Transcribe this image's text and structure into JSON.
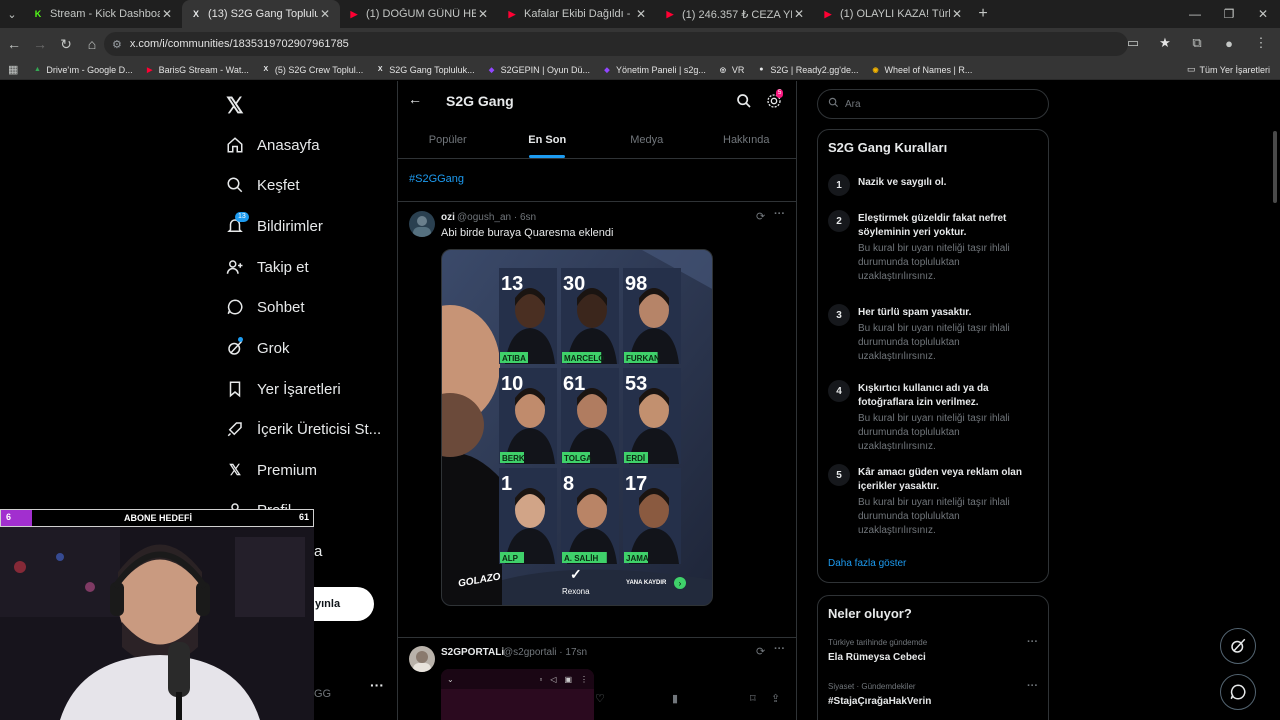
{
  "browser": {
    "tabs": [
      {
        "title": "Stream - Kick Dashboard",
        "fav": "K",
        "color": "#53fc18"
      },
      {
        "title": "(13) S2G Gang Topluluk / X",
        "fav": "X",
        "color": "#e7e9ea"
      },
      {
        "title": "(1) DOĞUM GÜNÜ HEDİYELERİ",
        "fav": "▶",
        "color": "#ff0033"
      },
      {
        "title": "Kafalar Ekibi Dağıldı - HESAP V",
        "fav": "▶",
        "color": "#ff0033"
      },
      {
        "title": "(1) 246.357 ₺ CEZA YEDİ! Türkiy",
        "fav": "▶",
        "color": "#ff0033"
      },
      {
        "title": "(1) OLAYLI KAZA! Türkiye'de Ya",
        "fav": "▶",
        "color": "#ff0033"
      }
    ],
    "url": "x.com/i/communities/1835319702907961785",
    "bookmarks": [
      "Drive'ım - Google D...",
      "BarisG Stream - Wat...",
      "(5) S2G Crew Toplul...",
      "S2G Gang Topluluk...",
      "S2GEPIN | Oyun Dü...",
      "Yönetim Paneli | s2g...",
      "VR",
      "S2G | Ready2.gg'de...",
      "Wheel of Names | R..."
    ],
    "all_bookmarks": "Tüm Yer İşaretleri"
  },
  "nav": {
    "home": "Anasayfa",
    "explore": "Keşfet",
    "notifications": "Bildirimler",
    "notif_count": "13",
    "follow": "Takip et",
    "chat": "Sohbet",
    "grok": "Grok",
    "bookmarks": "Yer İşaretleri",
    "creator": "İçerik Üreticisi St...",
    "premium": "Premium",
    "profile": "Profil",
    "more_partial": "a",
    "post_partial": "yınla",
    "account_partial": "GG"
  },
  "community": {
    "title": "S2G Gang",
    "settings_badge": "5",
    "tabs": [
      "Popüler",
      "En Son",
      "Medya",
      "Hakkında"
    ],
    "hashtag": "#S2GGang"
  },
  "post1": {
    "name": "ozi",
    "handle": "@ogush_an · 6sn",
    "text": "Abi birde buraya Quaresma eklendi",
    "players": [
      {
        "num": "13",
        "name": "ATIBA"
      },
      {
        "num": "30",
        "name": "MARCELO"
      },
      {
        "num": "98",
        "name": "FURKAN"
      },
      {
        "num": "10",
        "name": "BERK"
      },
      {
        "num": "61",
        "name": "TOLGA"
      },
      {
        "num": "53",
        "name": "ERDİ"
      },
      {
        "num": "1",
        "name": "ALP"
      },
      {
        "num": "8",
        "name": "A. SALİH"
      },
      {
        "num": "17",
        "name": "JAMA"
      }
    ],
    "brand_left": "GOLAZO",
    "brand_mid": "Rexona",
    "brand_right": "YANA KAYDIR"
  },
  "post2": {
    "name": "S2GPORTALi",
    "handle": "@s2gportali · 17sn"
  },
  "search_placeholder": "Ara",
  "rules": {
    "title": "S2G Gang Kuralları",
    "items": [
      {
        "n": "1",
        "title": "Nazik ve saygılı ol.",
        "desc": ""
      },
      {
        "n": "2",
        "title": "Eleştirmek güzeldir fakat nefret söyleminin yeri yoktur.",
        "desc": "Bu kural bir uyarı niteliği taşır ihlali durumunda topluluktan uzaklaştırılırsınız."
      },
      {
        "n": "3",
        "title": "Her türlü spam yasaktır.",
        "desc": "Bu kural bir uyarı niteliği taşır ihlali durumunda topluluktan uzaklaştırılırsınız."
      },
      {
        "n": "4",
        "title": "Kışkırtıcı kullanıcı adı ya da fotoğraflara izin verilmez.",
        "desc": "Bu kural bir uyarı niteliği taşır ihlali durumunda topluluktan uzaklaştırılırsınız."
      },
      {
        "n": "5",
        "title": "Kâr amacı güden veya reklam olan içerikler yasaktır.",
        "desc": "Bu kural bir uyarı niteliği taşır ihlali durumunda topluluktan uzaklaştırılırsınız."
      }
    ],
    "more": "Daha fazla göster"
  },
  "trends": {
    "title": "Neler oluyor?",
    "items": [
      {
        "meta": "Türkiye tarihinde gündemde",
        "name": "Ela Rümeysa Cebeci"
      },
      {
        "meta": "Siyaset · Gündemdekiler",
        "name": "#StajaÇırağaHakVerin"
      }
    ]
  },
  "overlay": {
    "label": "ABONE HEDEFİ",
    "current": "6",
    "goal": "61",
    "progress": 0.1
  },
  "colors": {
    "accent": "#1d9bf0",
    "bar": "#a22fcf",
    "pitch_green": "#3fd16a"
  }
}
